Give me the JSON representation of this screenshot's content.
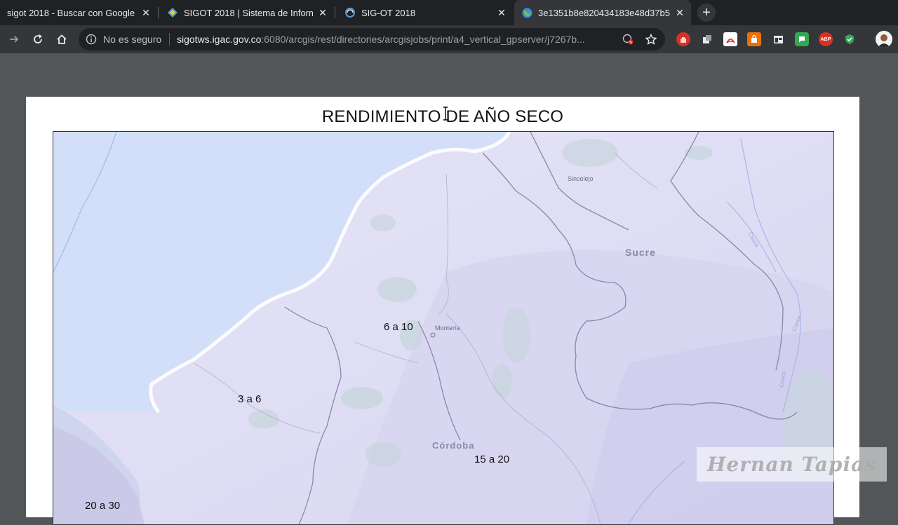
{
  "browser": {
    "tabs": [
      {
        "title": "sigot 2018 - Buscar con Google",
        "icon": "google-icon"
      },
      {
        "title": "SIGOT 2018 | Sistema de Informa",
        "icon": "sigot-icon"
      },
      {
        "title": "SIG-OT 2018",
        "icon": "arcgis-icon"
      },
      {
        "title": "3e1351b8e820434183e48d37b5f",
        "icon": "globe-icon",
        "active": true
      }
    ],
    "security_label": "No es seguro",
    "url_host": "sigotws.igac.gov.co",
    "url_rest": ":6080/arcgis/rest/directories/arcgisjobs/print/a4_vertical_gpserver/j7267b...",
    "extensions": [
      "hand-icon",
      "puzzle-icon",
      "pdf-icon",
      "bag-icon",
      "window-icon",
      "chat-icon",
      "adblock-icon",
      "shield-icon"
    ],
    "adblock_label": "ABP"
  },
  "map": {
    "title": "RENDIMIENTO DE AÑO SECO",
    "places": {
      "sincelejo": "Sincelejo",
      "sucre": "Sucre",
      "monteria": "Montería",
      "cordoba": "Córdoba",
      "rivers": [
        "Cauca",
        "Cauca",
        "Cauca"
      ]
    },
    "classes": {
      "c1": "6 a 10",
      "c2": "3 a 6",
      "c3": "15 a 20",
      "c4": "20 a 30"
    }
  },
  "watermark": "Hernan Tapias",
  "colors": {
    "tabbar": "#202124",
    "toolbar": "#35363a",
    "viewer_bg": "#525659",
    "sea": "#d5e0f8",
    "land": "#e3e1f6"
  }
}
